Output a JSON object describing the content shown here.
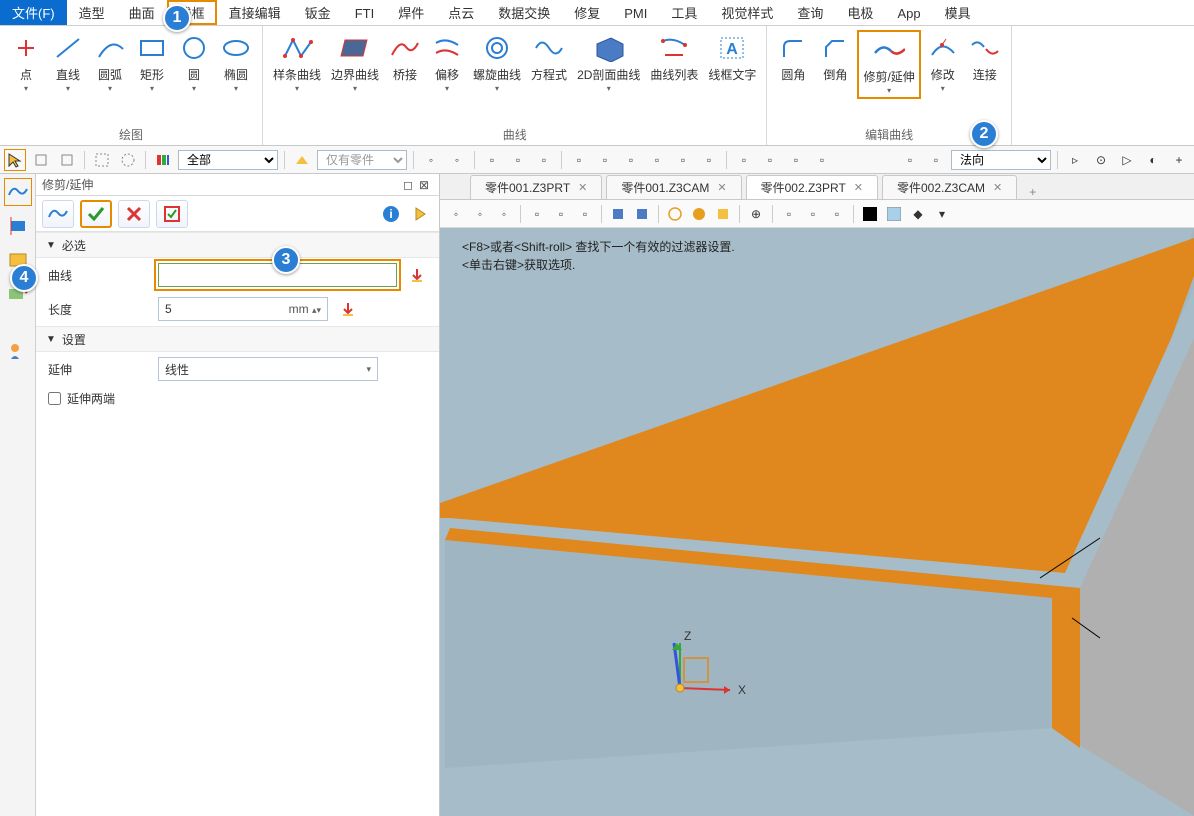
{
  "menu": {
    "file": "文件(F)",
    "items": [
      "造型",
      "曲面",
      "线框",
      "直接编辑",
      "钣金",
      "FTI",
      "焊件",
      "点云",
      "数据交换",
      "修复",
      "PMI",
      "工具",
      "视觉样式",
      "查询",
      "电极",
      "App",
      "模具"
    ]
  },
  "ribbon": {
    "draw": {
      "title": "绘图",
      "btns": [
        {
          "l": "点"
        },
        {
          "l": "直线"
        },
        {
          "l": "圆弧"
        },
        {
          "l": "矩形"
        },
        {
          "l": "圆"
        },
        {
          "l": "椭圆"
        }
      ]
    },
    "curve": {
      "title": "曲线",
      "btns": [
        {
          "l": "样条曲线"
        },
        {
          "l": "边界曲线"
        },
        {
          "l": "桥接"
        },
        {
          "l": "偏移"
        },
        {
          "l": "螺旋曲线"
        },
        {
          "l": "方程式"
        },
        {
          "l": "2D剖面曲线"
        },
        {
          "l": "曲线列表"
        },
        {
          "l": "线框文字"
        }
      ]
    },
    "edit": {
      "title": "编辑曲线",
      "btns": [
        {
          "l": "圆角"
        },
        {
          "l": "倒角"
        },
        {
          "l": "修剪/延伸"
        },
        {
          "l": "修改"
        },
        {
          "l": "连接"
        }
      ]
    }
  },
  "toolbar": {
    "combo1": "全部",
    "combo2": "仅有零件",
    "combo3": "法向"
  },
  "panel": {
    "title": "修剪/延伸",
    "sec1": "必选",
    "sec2": "设置",
    "curveLabel": "曲线",
    "curveVal": "",
    "lenLabel": "长度",
    "lenVal": "5",
    "lenUnit": "mm",
    "extLabel": "延伸",
    "extVal": "线性",
    "bothEnds": "延伸两端"
  },
  "tabs": [
    {
      "t": "零件001.Z3PRT",
      "a": false
    },
    {
      "t": "零件001.Z3CAM",
      "a": false
    },
    {
      "t": "零件002.Z3PRT",
      "a": true
    },
    {
      "t": "零件002.Z3CAM",
      "a": false
    }
  ],
  "hint": {
    "l1": "<F8>或者<Shift-roll> 查找下一个有效的过滤器设置.",
    "l2": "<单击右键>获取选项."
  },
  "axis": {
    "x": "X",
    "z": "Z"
  }
}
